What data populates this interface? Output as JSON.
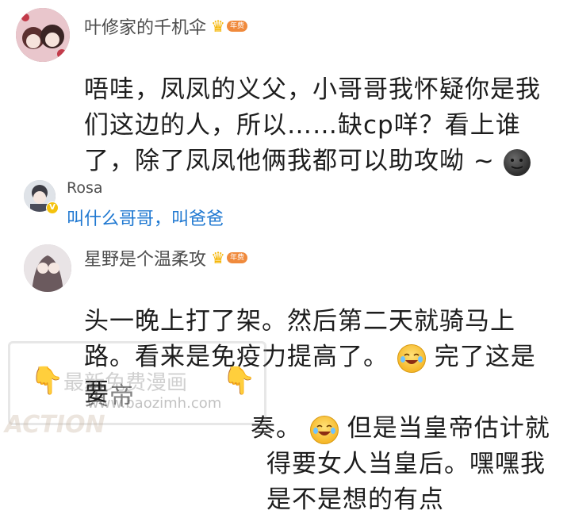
{
  "comments": [
    {
      "username": "叶修家的千机伞",
      "badge": "年费",
      "text_lines": [
        "唔哇，凤凤的义父，小哥哥我怀疑你是我",
        "们这边的人，所以……缺cp咩？看上谁",
        "了，除了凤凤他俩我都可以助攻呦 ~"
      ],
      "emoji": "dark-moon-face"
    },
    {
      "username": "Rosa",
      "badge": "V",
      "reply_text": "叫什么哥哥，叫爸爸"
    },
    {
      "username": "星野是个温柔攻",
      "badge": "年费",
      "text_lines": [
        "头一晚上打了架。然后第二天就骑马上",
        "路。看来是免疫力提高了。",
        "完了这是要",
        "奏。",
        "但是当皇帝估计就",
        "得要女人当皇后。嘿嘿我是不是想的有点"
      ],
      "emoji": "tears-of-joy-face"
    }
  ],
  "watermark": {
    "line1": "最新免费漫画",
    "line2": "www.baozimh.com",
    "line3": "ACTION",
    "overlap": "黄帝"
  },
  "colors": {
    "accent_blue": "#1f78d1",
    "crown_gold": "#f5b400",
    "badge_orange": "#f08a3c"
  }
}
